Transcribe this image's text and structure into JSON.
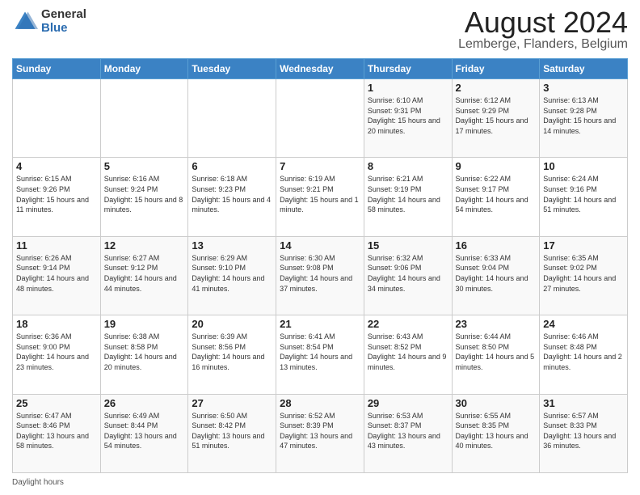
{
  "header": {
    "logo_general": "General",
    "logo_blue": "Blue",
    "month_title": "August 2024",
    "subtitle": "Lemberge, Flanders, Belgium"
  },
  "days_of_week": [
    "Sunday",
    "Monday",
    "Tuesday",
    "Wednesday",
    "Thursday",
    "Friday",
    "Saturday"
  ],
  "weeks": [
    [
      {
        "day": "",
        "info": ""
      },
      {
        "day": "",
        "info": ""
      },
      {
        "day": "",
        "info": ""
      },
      {
        "day": "",
        "info": ""
      },
      {
        "day": "1",
        "info": "Sunrise: 6:10 AM\nSunset: 9:31 PM\nDaylight: 15 hours and 20 minutes."
      },
      {
        "day": "2",
        "info": "Sunrise: 6:12 AM\nSunset: 9:29 PM\nDaylight: 15 hours and 17 minutes."
      },
      {
        "day": "3",
        "info": "Sunrise: 6:13 AM\nSunset: 9:28 PM\nDaylight: 15 hours and 14 minutes."
      }
    ],
    [
      {
        "day": "4",
        "info": "Sunrise: 6:15 AM\nSunset: 9:26 PM\nDaylight: 15 hours and 11 minutes."
      },
      {
        "day": "5",
        "info": "Sunrise: 6:16 AM\nSunset: 9:24 PM\nDaylight: 15 hours and 8 minutes."
      },
      {
        "day": "6",
        "info": "Sunrise: 6:18 AM\nSunset: 9:23 PM\nDaylight: 15 hours and 4 minutes."
      },
      {
        "day": "7",
        "info": "Sunrise: 6:19 AM\nSunset: 9:21 PM\nDaylight: 15 hours and 1 minute."
      },
      {
        "day": "8",
        "info": "Sunrise: 6:21 AM\nSunset: 9:19 PM\nDaylight: 14 hours and 58 minutes."
      },
      {
        "day": "9",
        "info": "Sunrise: 6:22 AM\nSunset: 9:17 PM\nDaylight: 14 hours and 54 minutes."
      },
      {
        "day": "10",
        "info": "Sunrise: 6:24 AM\nSunset: 9:16 PM\nDaylight: 14 hours and 51 minutes."
      }
    ],
    [
      {
        "day": "11",
        "info": "Sunrise: 6:26 AM\nSunset: 9:14 PM\nDaylight: 14 hours and 48 minutes."
      },
      {
        "day": "12",
        "info": "Sunrise: 6:27 AM\nSunset: 9:12 PM\nDaylight: 14 hours and 44 minutes."
      },
      {
        "day": "13",
        "info": "Sunrise: 6:29 AM\nSunset: 9:10 PM\nDaylight: 14 hours and 41 minutes."
      },
      {
        "day": "14",
        "info": "Sunrise: 6:30 AM\nSunset: 9:08 PM\nDaylight: 14 hours and 37 minutes."
      },
      {
        "day": "15",
        "info": "Sunrise: 6:32 AM\nSunset: 9:06 PM\nDaylight: 14 hours and 34 minutes."
      },
      {
        "day": "16",
        "info": "Sunrise: 6:33 AM\nSunset: 9:04 PM\nDaylight: 14 hours and 30 minutes."
      },
      {
        "day": "17",
        "info": "Sunrise: 6:35 AM\nSunset: 9:02 PM\nDaylight: 14 hours and 27 minutes."
      }
    ],
    [
      {
        "day": "18",
        "info": "Sunrise: 6:36 AM\nSunset: 9:00 PM\nDaylight: 14 hours and 23 minutes."
      },
      {
        "day": "19",
        "info": "Sunrise: 6:38 AM\nSunset: 8:58 PM\nDaylight: 14 hours and 20 minutes."
      },
      {
        "day": "20",
        "info": "Sunrise: 6:39 AM\nSunset: 8:56 PM\nDaylight: 14 hours and 16 minutes."
      },
      {
        "day": "21",
        "info": "Sunrise: 6:41 AM\nSunset: 8:54 PM\nDaylight: 14 hours and 13 minutes."
      },
      {
        "day": "22",
        "info": "Sunrise: 6:43 AM\nSunset: 8:52 PM\nDaylight: 14 hours and 9 minutes."
      },
      {
        "day": "23",
        "info": "Sunrise: 6:44 AM\nSunset: 8:50 PM\nDaylight: 14 hours and 5 minutes."
      },
      {
        "day": "24",
        "info": "Sunrise: 6:46 AM\nSunset: 8:48 PM\nDaylight: 14 hours and 2 minutes."
      }
    ],
    [
      {
        "day": "25",
        "info": "Sunrise: 6:47 AM\nSunset: 8:46 PM\nDaylight: 13 hours and 58 minutes."
      },
      {
        "day": "26",
        "info": "Sunrise: 6:49 AM\nSunset: 8:44 PM\nDaylight: 13 hours and 54 minutes."
      },
      {
        "day": "27",
        "info": "Sunrise: 6:50 AM\nSunset: 8:42 PM\nDaylight: 13 hours and 51 minutes."
      },
      {
        "day": "28",
        "info": "Sunrise: 6:52 AM\nSunset: 8:39 PM\nDaylight: 13 hours and 47 minutes."
      },
      {
        "day": "29",
        "info": "Sunrise: 6:53 AM\nSunset: 8:37 PM\nDaylight: 13 hours and 43 minutes."
      },
      {
        "day": "30",
        "info": "Sunrise: 6:55 AM\nSunset: 8:35 PM\nDaylight: 13 hours and 40 minutes."
      },
      {
        "day": "31",
        "info": "Sunrise: 6:57 AM\nSunset: 8:33 PM\nDaylight: 13 hours and 36 minutes."
      }
    ]
  ],
  "footer": {
    "daylight_label": "Daylight hours"
  }
}
